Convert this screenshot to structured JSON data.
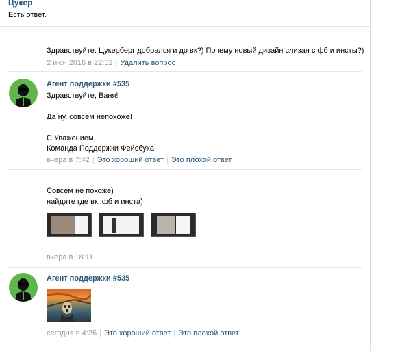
{
  "topic": {
    "title": "Цукер",
    "status": "Есть ответ."
  },
  "messages": [
    {
      "text_lines": [
        "Здравствуйте. Цукерберг добрался и до вк?) Почему новый дизайн слизан с фб и инсты?)"
      ],
      "time": "2 июн 2016 в 22:52",
      "action": "Удалить вопрос"
    },
    {
      "author": "Агент поддержки #535",
      "text_lines": [
        "Здравствуйте, Ваня!",
        "Да ну, совсем непохоже!",
        "С Уважением,",
        "Команда Поддержки Фейсбука"
      ],
      "time": "вчера в 7:42",
      "good": "Это хороший ответ",
      "bad": "Это плохой ответ"
    },
    {
      "text_lines": [
        "Совсем не похоже)",
        "найдите где вк, фб и инста)"
      ],
      "time": "вчера в 18:11",
      "images": [
        "screenshot-vk",
        "screenshot-fb",
        "screenshot-insta"
      ]
    },
    {
      "author": "Агент поддержки #535",
      "image": "scream-painting",
      "time": "сегодня в 4:26",
      "good": "Это хороший ответ",
      "bad": "Это плохой ответ"
    }
  ],
  "colors": {
    "link": "#2b587a",
    "meta": "#999999",
    "avatar_bg": "#5fb64c"
  }
}
